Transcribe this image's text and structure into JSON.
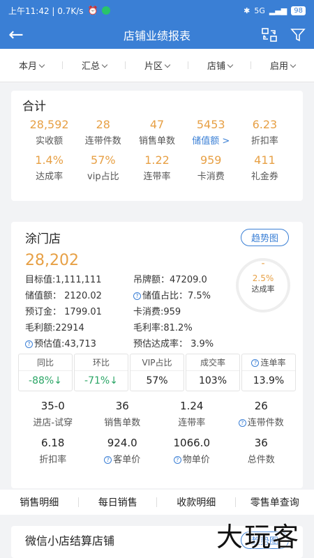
{
  "status_bar": {
    "time_speed": "上午11:42 | 0.7K/s",
    "signal": "5G",
    "battery": "98"
  },
  "header": {
    "title": "店铺业绩报表"
  },
  "filters": [
    "本月",
    "汇总",
    "片区",
    "店铺",
    "启用"
  ],
  "summary": {
    "title": "合计",
    "row1": [
      {
        "value": "28,592",
        "label": "实收额"
      },
      {
        "value": "28",
        "label": "连带件数"
      },
      {
        "value": "47",
        "label": "销售单数"
      },
      {
        "value": "5453",
        "label": "储值额 >"
      },
      {
        "value": "6.23",
        "label": "折扣率"
      }
    ],
    "row2": [
      {
        "value": "1.4%",
        "label": "达成率"
      },
      {
        "value": "57%",
        "label": "vip占比"
      },
      {
        "value": "1.22",
        "label": "连带率"
      },
      {
        "value": "959",
        "label": "卡消费"
      },
      {
        "value": "411",
        "label": "礼金券"
      }
    ]
  },
  "store": {
    "name": "涂门店",
    "trend_label": "趋势图",
    "amount": "28,202",
    "gauge": {
      "dash": "-",
      "pct": "2.5%",
      "label": "达成率"
    },
    "info": {
      "target": "目标值:1,111,111",
      "tag_amount": "吊牌额：47209.0",
      "stored": "储值额：  2120.02",
      "stored_ratio": "储值占比：7.5%",
      "deposit": "预订金：  1799.01",
      "card_spend": "卡消费:959",
      "gross_profit": "毛利额:22914",
      "gross_rate": "毛利率:81.2%",
      "estimate": "预估值:43,713",
      "estimate_rate": "预估达成率：  3.9%"
    },
    "compare": [
      {
        "head": "同比",
        "value": "-88%↓"
      },
      {
        "head": "环比",
        "value": "-71%↓"
      },
      {
        "head": "VIP占比",
        "value": "57%"
      },
      {
        "head": "成交率",
        "value": "103%"
      },
      {
        "head": "连单率",
        "value": "13.9%"
      }
    ],
    "stats": [
      {
        "value": "35-0",
        "label": "进店-试穿"
      },
      {
        "value": "36",
        "label": "销售单数"
      },
      {
        "value": "1.24",
        "label": "连带率"
      },
      {
        "value": "26",
        "label": "连带件数"
      },
      {
        "value": "6.18",
        "label": "折扣率"
      },
      {
        "value": "924.0",
        "label": "客单价"
      },
      {
        "value": "1066.0",
        "label": "物单价"
      },
      {
        "value": "36",
        "label": "总件数"
      }
    ]
  },
  "tabs": [
    "销售明细",
    "每日销售",
    "收款明细",
    "零售单查询"
  ],
  "next_store": {
    "name": "微信小店结算店铺",
    "trend_label": "趋势图"
  },
  "watermark": "大玩客",
  "colors": {
    "primary": "#3a7fd5",
    "accent": "#e7a045",
    "down": "#2aa565"
  }
}
